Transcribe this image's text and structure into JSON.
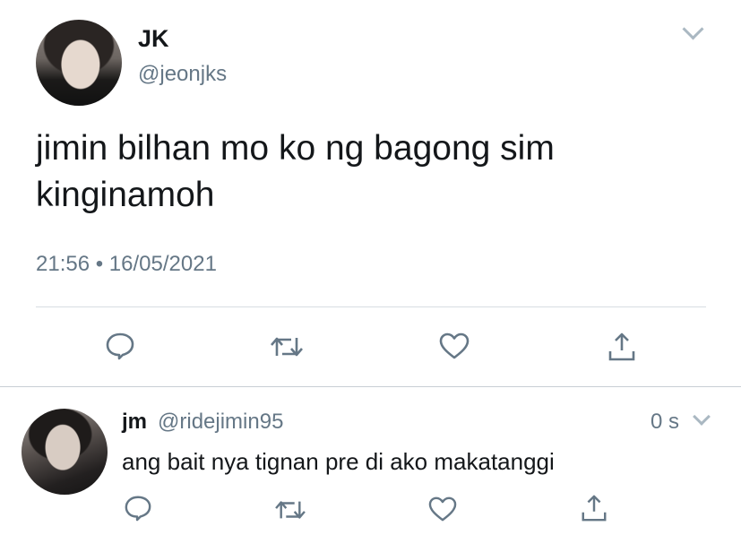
{
  "tweet": {
    "author_name": "JK",
    "author_handle": "@jeonjks",
    "text_line1": "jimin bilhan mo ko ng bagong sim",
    "text_line2": "kinginamoh",
    "timestamp": "21:56 • 16/05/2021",
    "icons": [
      "reply-icon",
      "retweet-icon",
      "like-icon",
      "share-icon"
    ]
  },
  "reply": {
    "author_name": "jm",
    "author_handle": "@ridejimin95",
    "time": "0 s",
    "text": "ang bait nya tignan pre di ako makatanggi",
    "icons": [
      "reply-icon",
      "retweet-icon",
      "like-icon",
      "share-icon"
    ]
  },
  "colors": {
    "text": "#14171a",
    "secondary": "#657786",
    "icon": "#657786",
    "divider": "#d7dde2"
  }
}
